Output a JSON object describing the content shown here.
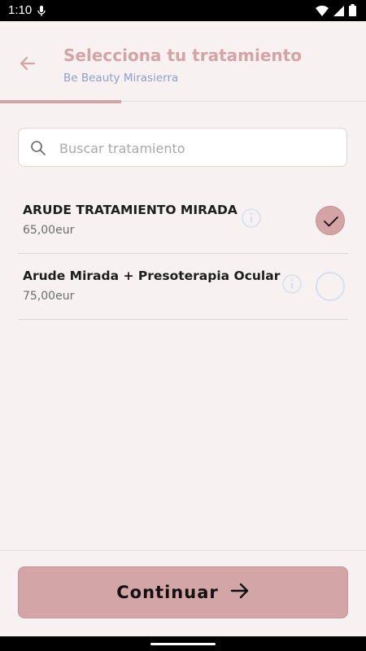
{
  "status_bar": {
    "time": "1:10"
  },
  "header": {
    "title": "Selecciona tu tratamiento",
    "subtitle": "Be Beauty Mirasierra",
    "progress_percent": 33
  },
  "search": {
    "placeholder": "Buscar tratamiento",
    "value": ""
  },
  "treatments": [
    {
      "name": "ARUDE TRATAMIENTO MIRADA",
      "price": "65,00eur",
      "selected": true
    },
    {
      "name": "Arude Mirada + Presoterapia Ocular",
      "price": "75,00eur",
      "selected": false
    }
  ],
  "footer": {
    "continue_label": "Continuar"
  },
  "colors": {
    "accent": "#d4a3a5",
    "subtitle": "#8da0c4",
    "background": "#f7f2f1"
  },
  "icons": [
    "mic-icon",
    "wifi-icon",
    "signal-icon",
    "battery-icon",
    "back-arrow-icon",
    "search-icon",
    "info-icon",
    "check-icon",
    "arrow-right-icon"
  ]
}
